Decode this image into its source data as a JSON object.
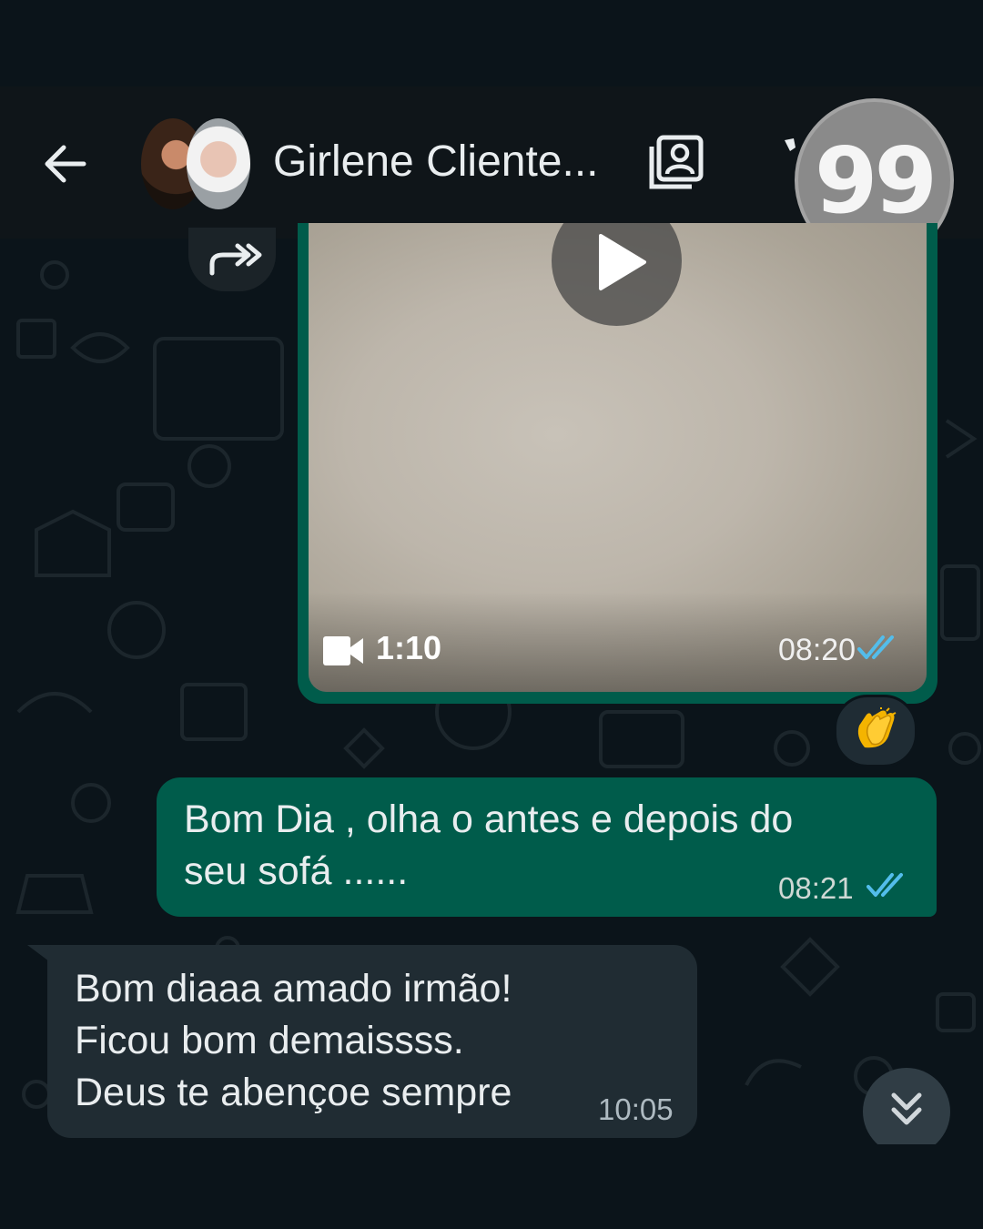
{
  "header": {
    "title": "Girlene Cliente...",
    "back_icon": "arrow-left-icon",
    "contact_icon": "contact-card-icon",
    "badge_text": "99"
  },
  "messages": {
    "video": {
      "duration": "1:10",
      "time": "08:20",
      "status": "read",
      "reaction": "👏"
    },
    "outgoing": {
      "text": "Bom Dia , olha o antes e depois do\nseu sofá ......",
      "time": "08:21",
      "status": "read"
    },
    "incoming": {
      "text": "Bom diaaa amado irmão!\nFicou bom demaissss.\nDeus te abençoe sempre",
      "time": "10:05"
    }
  },
  "colors": {
    "outgoing_bubble": "#005c4b",
    "incoming_bubble": "#202c33",
    "read_ticks": "#53bdeb",
    "background": "#0b141a"
  }
}
